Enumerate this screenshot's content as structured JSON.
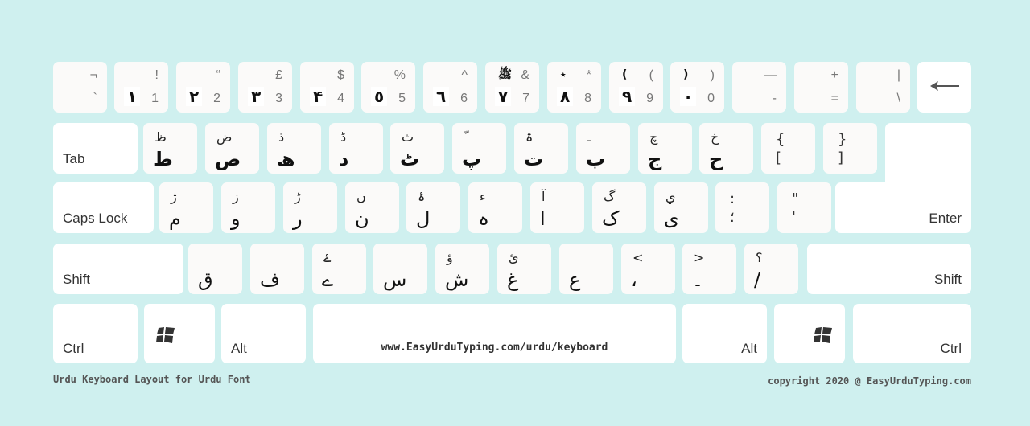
{
  "colors": {
    "background": "#cff0ef",
    "key": "#fbfaf9",
    "modifier_key": "#ffffff",
    "text": "#333333",
    "muted": "#777777"
  },
  "number_row": [
    {
      "shift": "¬",
      "normal": "`",
      "urdu": "",
      "urdu_shift": ""
    },
    {
      "shift": "!",
      "normal": "1",
      "urdu": "١",
      "urdu_shift": ""
    },
    {
      "shift": "“",
      "normal": "2",
      "urdu": "٢",
      "urdu_shift": ""
    },
    {
      "shift": "£",
      "normal": "3",
      "urdu": "٣",
      "urdu_shift": ""
    },
    {
      "shift": "$",
      "normal": "4",
      "urdu": "۴",
      "urdu_shift": ""
    },
    {
      "shift": "%",
      "normal": "5",
      "urdu": "٥",
      "urdu_shift": ""
    },
    {
      "shift": "^",
      "normal": "6",
      "urdu": "٦",
      "urdu_shift": ""
    },
    {
      "shift": "&",
      "normal": "7",
      "urdu": "٧",
      "urdu_shift": "ﷺ"
    },
    {
      "shift": "*",
      "normal": "8",
      "urdu": "٨",
      "urdu_shift": "٭"
    },
    {
      "shift": "(",
      "normal": "9",
      "urdu": "٩",
      "urdu_shift": "("
    },
    {
      "shift": ")",
      "normal": "0",
      "urdu": "٠",
      "urdu_shift": ")"
    },
    {
      "shift": "—",
      "normal": "-",
      "urdu": "",
      "urdu_shift": ""
    },
    {
      "shift": "+",
      "normal": "=",
      "urdu": "",
      "urdu_shift": ""
    },
    {
      "shift": "|",
      "normal": "\\",
      "urdu": "",
      "urdu_shift": ""
    }
  ],
  "backspace": {
    "icon": "backspace-arrow-icon"
  },
  "tab_row": {
    "label": "Tab",
    "keys": [
      {
        "shift": "ظ",
        "normal": "ط"
      },
      {
        "shift": "ض",
        "normal": "ص"
      },
      {
        "shift": "ذ",
        "normal": "ھ"
      },
      {
        "shift": "ڈ",
        "normal": "د"
      },
      {
        "shift": "ث",
        "normal": "ٹ"
      },
      {
        "shift": "ّ",
        "normal": "پ"
      },
      {
        "shift": "ۃ",
        "normal": "ت"
      },
      {
        "shift": "ـ",
        "normal": "ب"
      },
      {
        "shift": "چ",
        "normal": "ج"
      },
      {
        "shift": "خ",
        "normal": "ح"
      },
      {
        "shift": "{",
        "normal": "["
      },
      {
        "shift": "}",
        "normal": "]"
      }
    ]
  },
  "caps_row": {
    "label": "Caps Lock",
    "keys": [
      {
        "shift": "ژ",
        "normal": "م"
      },
      {
        "shift": "ز",
        "normal": "و"
      },
      {
        "shift": "ڑ",
        "normal": "ر"
      },
      {
        "shift": "ں",
        "normal": "ن"
      },
      {
        "shift": "ۂ",
        "normal": "ل"
      },
      {
        "shift": "ء",
        "normal": "ہ"
      },
      {
        "shift": "آ",
        "normal": "ا"
      },
      {
        "shift": "گ",
        "normal": "ک"
      },
      {
        "shift": "ي",
        "normal": "ی"
      },
      {
        "shift": ":",
        "normal": "؛"
      },
      {
        "shift": "\"",
        "normal": "'"
      }
    ],
    "enter_label": "Enter"
  },
  "shift_row": {
    "left_label": "Shift",
    "right_label": "Shift",
    "keys": [
      {
        "shift": "",
        "normal": "ق"
      },
      {
        "shift": "",
        "normal": "ف"
      },
      {
        "shift": "ۓ",
        "normal": "ے"
      },
      {
        "shift": "",
        "normal": "س"
      },
      {
        "shift": "ؤ",
        "normal": "ش"
      },
      {
        "shift": "ئ",
        "normal": "غ"
      },
      {
        "shift": "",
        "normal": "ع"
      },
      {
        "shift": "<",
        "normal": "،"
      },
      {
        "shift": ">",
        "normal": "۔"
      },
      {
        "shift": "؟",
        "normal": "/"
      }
    ]
  },
  "bottom_row": {
    "ctrl_left": "Ctrl",
    "alt_left": "Alt",
    "space_text": "www.EasyUrduTyping.com/urdu/keyboard",
    "alt_right": "Alt",
    "ctrl_right": "Ctrl"
  },
  "footer": {
    "left": "Urdu Keyboard Layout for Urdu Font",
    "right": "copyright 2020 @ EasyUrduTyping.com"
  }
}
